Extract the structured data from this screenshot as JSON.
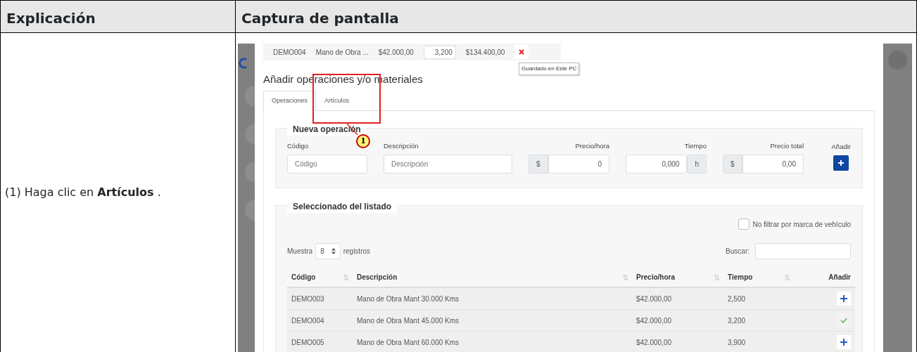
{
  "headers": [
    "Explicación",
    "Captura de pantalla"
  ],
  "explanation": "(1) Haga clic en **Artículos** .",
  "screenshot": {
    "selected_row": {
      "code": "DEMO004",
      "description": "Mano de Obra ...",
      "price": "$42.000,00",
      "quantity": "3,200",
      "total": "$134.400,00"
    },
    "tooltip": "Guardado en Este PC",
    "heading": "Añadir operaciones y/o materiales",
    "tabs": [
      {
        "label": "Operaciones",
        "selected": true
      },
      {
        "label": "Artículos",
        "selected": false
      }
    ],
    "new_operation": {
      "legend": "Nueva operación",
      "add_label": "Añadir",
      "fields": [
        {
          "kind": "text",
          "label": "Código",
          "placeholder": "Código"
        },
        {
          "kind": "text",
          "label": "Descripción",
          "placeholder": "Descripción"
        },
        {
          "kind": "number",
          "label": "Precio/hora",
          "prefix": "$",
          "value": "0"
        },
        {
          "kind": "number",
          "label": "Tiempo",
          "value": "0,000",
          "suffix": "h"
        },
        {
          "kind": "number",
          "label": "Precio total",
          "prefix": "$",
          "value": "0,00"
        }
      ]
    },
    "list": {
      "legend": "Seleccionado del listado",
      "filter": {
        "label": "No filtrar por marca de vehículo",
        "checked": false
      },
      "show_label": "Muestra",
      "page_size": "8",
      "records_label": "registros",
      "search_label": "Buscar:",
      "columns": [
        "Código",
        "Descripción",
        "Precio/hora",
        "Tiempo",
        "Añadir"
      ],
      "rows": [
        {
          "code": "DEMO003",
          "description": "Mano de Obra Mant 30.000 Kms",
          "price": "$42.000,00",
          "time": "2,500",
          "added": false
        },
        {
          "code": "DEMO004",
          "description": "Mano de Obra Mant 45.000 Kms",
          "price": "$42.000,00",
          "time": "3,200",
          "added": true
        },
        {
          "code": "DEMO005",
          "description": "Mano de Obra Mant 60.000 Kms",
          "price": "$42.000,00",
          "time": "3,900",
          "added": false
        }
      ]
    },
    "callout": "1"
  }
}
